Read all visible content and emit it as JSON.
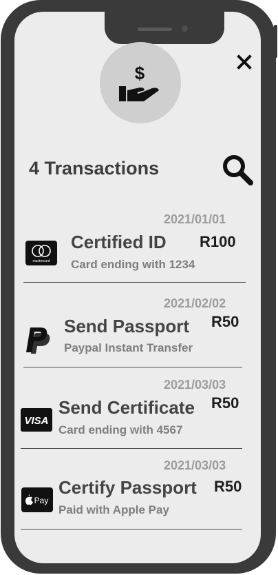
{
  "header": {
    "close_icon": "close-icon",
    "hero_icon": "hand-dollar-icon",
    "title": "4 Transactions",
    "search_icon": "search-icon"
  },
  "transactions": [
    {
      "date": "2021/01/01",
      "name": "Certified ID",
      "amount": "R100",
      "detail": "Card ending with 1234",
      "method_icon": "mastercard-icon",
      "mastercard_text": "mastercard"
    },
    {
      "date": "2021/02/02",
      "name": "Send Passport",
      "amount": "R50",
      "detail": "Paypal Instant Transfer",
      "method_icon": "paypal-icon"
    },
    {
      "date": "2021/03/03",
      "name": "Send Certificate",
      "amount": "R50",
      "detail": "Card ending with 4567",
      "method_icon": "visa-icon",
      "visa_text": "VISA"
    },
    {
      "date": "2021/03/03",
      "name": "Certify Passport",
      "amount": "R50",
      "detail": "Paid with Apple Pay",
      "method_icon": "apple-pay-icon",
      "applepay_text": "Pay"
    }
  ],
  "colors": {
    "frame": "#3a3a3a",
    "screen": "#ececec",
    "circle": "#cfcfcf"
  }
}
